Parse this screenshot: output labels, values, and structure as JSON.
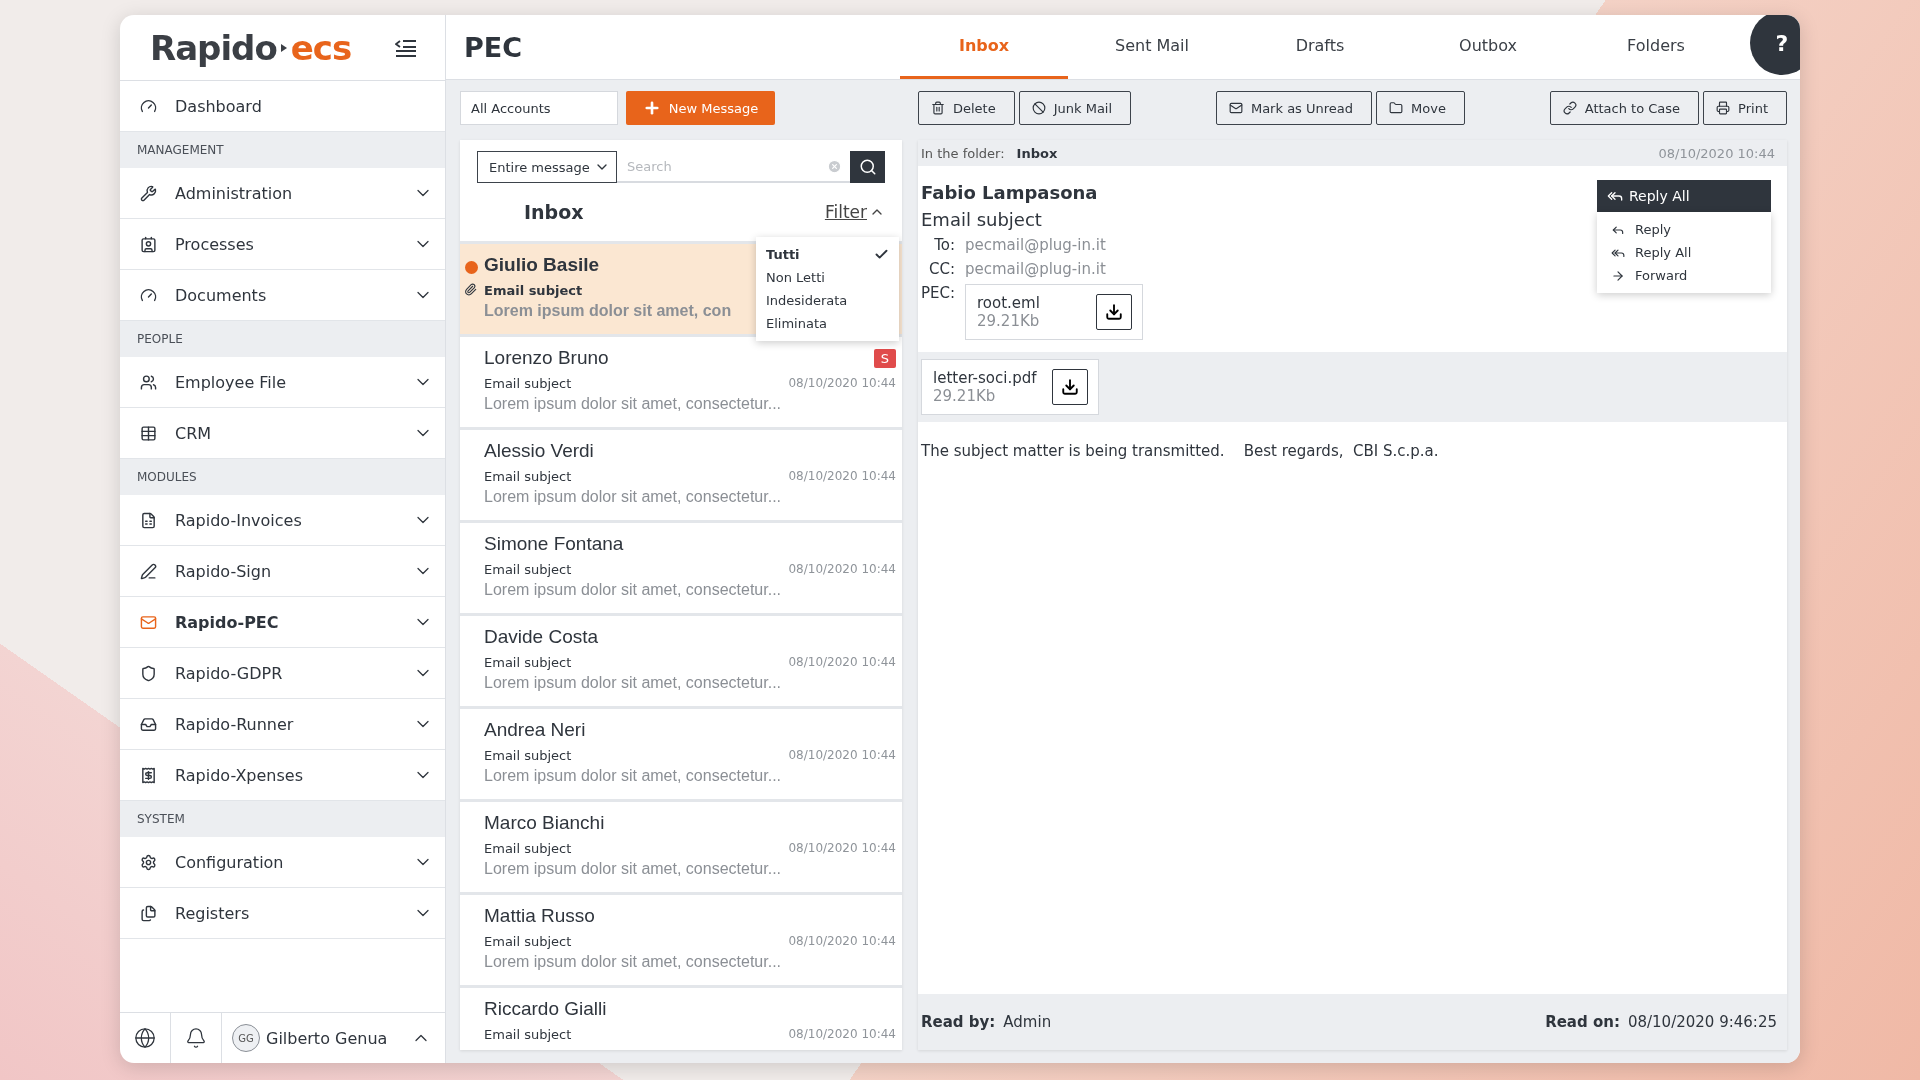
{
  "sidebar": {
    "logo": {
      "first": "Rapido",
      "second": "ecs"
    },
    "items": [
      {
        "kind": "link",
        "label": "Dashboard",
        "expandable": false,
        "selected": false
      },
      {
        "kind": "header",
        "label": "MANAGEMENT"
      },
      {
        "kind": "link",
        "label": "Administration",
        "expandable": true,
        "selected": false
      },
      {
        "kind": "link",
        "label": "Processes",
        "expandable": true,
        "selected": false
      },
      {
        "kind": "link",
        "label": "Documents",
        "expandable": true,
        "selected": false
      },
      {
        "kind": "header",
        "label": "PEOPLE"
      },
      {
        "kind": "link",
        "label": "Employee File",
        "expandable": true,
        "selected": false
      },
      {
        "kind": "link",
        "label": "CRM",
        "expandable": true,
        "selected": false
      },
      {
        "kind": "header",
        "label": "MODULES"
      },
      {
        "kind": "link",
        "label": "Rapido-Invoices",
        "expandable": true,
        "selected": false
      },
      {
        "kind": "link",
        "label": "Rapido-Sign",
        "expandable": true,
        "selected": false
      },
      {
        "kind": "link",
        "label": "Rapido-PEC",
        "expandable": true,
        "selected": true
      },
      {
        "kind": "link",
        "label": "Rapido-GDPR",
        "expandable": true,
        "selected": false
      },
      {
        "kind": "link",
        "label": "Rapido-Runner",
        "expandable": true,
        "selected": false
      },
      {
        "kind": "link",
        "label": "Rapido-Xpenses",
        "expandable": true,
        "selected": false
      },
      {
        "kind": "header",
        "label": "SYSTEM"
      },
      {
        "kind": "link",
        "label": "Configuration",
        "expandable": true,
        "selected": false
      },
      {
        "kind": "link",
        "label": "Registers",
        "expandable": true,
        "selected": false
      }
    ],
    "footer": {
      "avatar": "GG",
      "user": "Gilberto Genua"
    }
  },
  "header": {
    "title": "PEC",
    "help": "?"
  },
  "tabs": [
    {
      "label": "Inbox",
      "selected": true
    },
    {
      "label": "Sent Mail",
      "selected": false
    },
    {
      "label": "Drafts",
      "selected": false
    },
    {
      "label": "Outbox",
      "selected": false
    },
    {
      "label": "Folders",
      "selected": false
    }
  ],
  "accounts": {
    "value": "All Accounts"
  },
  "new_message": "New Message",
  "toolbar": {
    "groups": [
      [
        {
          "label": "Delete"
        },
        {
          "label": "Junk Mail"
        }
      ],
      [
        {
          "label": "Mark as Unread"
        },
        {
          "label": "Move"
        }
      ],
      [
        {
          "label": "Attach to Case"
        },
        {
          "label": "Print"
        }
      ]
    ]
  },
  "message_list": {
    "scope": "Entire message",
    "search": {
      "placeholder": "Search"
    },
    "title": "Inbox",
    "filter": {
      "label": "Filter",
      "expanded": true,
      "options": [
        {
          "label": "Tutti",
          "selected": true
        },
        {
          "label": "Non Letti",
          "selected": false
        },
        {
          "label": "Indesiderata",
          "selected": false
        },
        {
          "label": "Eliminata",
          "selected": false
        }
      ]
    },
    "messages": [
      {
        "name": "Giulio Basile",
        "subject": "Email subject",
        "preview": "Lorem ipsum dolor sit amet, con",
        "unread": true,
        "selected": true,
        "attachment": true
      },
      {
        "name": "Lorenzo Bruno",
        "badge": "S",
        "subject": "Email subject",
        "date": "08/10/2020 10:44",
        "preview": "Lorem ipsum dolor sit amet, consectetur...",
        "unread": false,
        "selected": false,
        "attachment": false
      },
      {
        "name": "Alessio Verdi",
        "subject": "Email subject",
        "date": "08/10/2020 10:44",
        "preview": "Lorem ipsum dolor sit amet, consectetur...",
        "unread": false,
        "selected": false,
        "attachment": false
      },
      {
        "name": "Simone Fontana",
        "subject": "Email subject",
        "date": "08/10/2020 10:44",
        "preview": "Lorem ipsum dolor sit amet, consectetur...",
        "unread": false,
        "selected": false,
        "attachment": false
      },
      {
        "name": "Davide Costa",
        "subject": "Email subject",
        "date": "08/10/2020 10:44",
        "preview": "Lorem ipsum dolor sit amet, consectetur...",
        "unread": false,
        "selected": false,
        "attachment": false
      },
      {
        "name": "Andrea Neri",
        "subject": "Email subject",
        "date": "08/10/2020 10:44",
        "preview": "Lorem ipsum dolor sit amet, consectetur...",
        "unread": false,
        "selected": false,
        "attachment": false
      },
      {
        "name": "Marco Bianchi",
        "subject": "Email subject",
        "date": "08/10/2020 10:44",
        "preview": "Lorem ipsum dolor sit amet, consectetur...",
        "unread": false,
        "selected": false,
        "attachment": false
      },
      {
        "name": "Mattia Russo",
        "subject": "Email subject",
        "date": "08/10/2020 10:44",
        "preview": "Lorem ipsum dolor sit amet, consectetur...",
        "unread": false,
        "selected": false,
        "attachment": false
      },
      {
        "name": "Riccardo Gialli",
        "subject": "Email subject",
        "date": "08/10/2020 10:44",
        "unread": false,
        "selected": false,
        "attachment": false
      }
    ]
  },
  "reader": {
    "folder_label": "In the folder:",
    "folder": "Inbox",
    "date": "08/10/2020 10:44",
    "sender": "Fabio Lampasona",
    "subject": "Email subject",
    "to_label": "To:",
    "to": "pecmail@plug-in.it",
    "cc_label": "CC:",
    "cc": "pecmail@plug-in.it",
    "pec_label": "PEC:",
    "pec_file": {
      "name": "root.eml",
      "size": "29.21Kb"
    },
    "reply": {
      "label": "Reply All",
      "expanded": true,
      "options": [
        {
          "kind": "reply",
          "label": "Reply"
        },
        {
          "kind": "reply_all",
          "label": "Reply All"
        },
        {
          "kind": "forward",
          "label": "Forward"
        }
      ]
    },
    "attachments": [
      {
        "name": "letter-soci.pdf",
        "size": "29.21Kb"
      }
    ],
    "body": "The subject matter is being transmitted.    Best regards,  CBI S.c.p.a.",
    "read_by_label": "Read by:",
    "read_by": "Admin",
    "read_on_label": "Read on:",
    "read_on": "08/10/2020 9:46:25"
  }
}
